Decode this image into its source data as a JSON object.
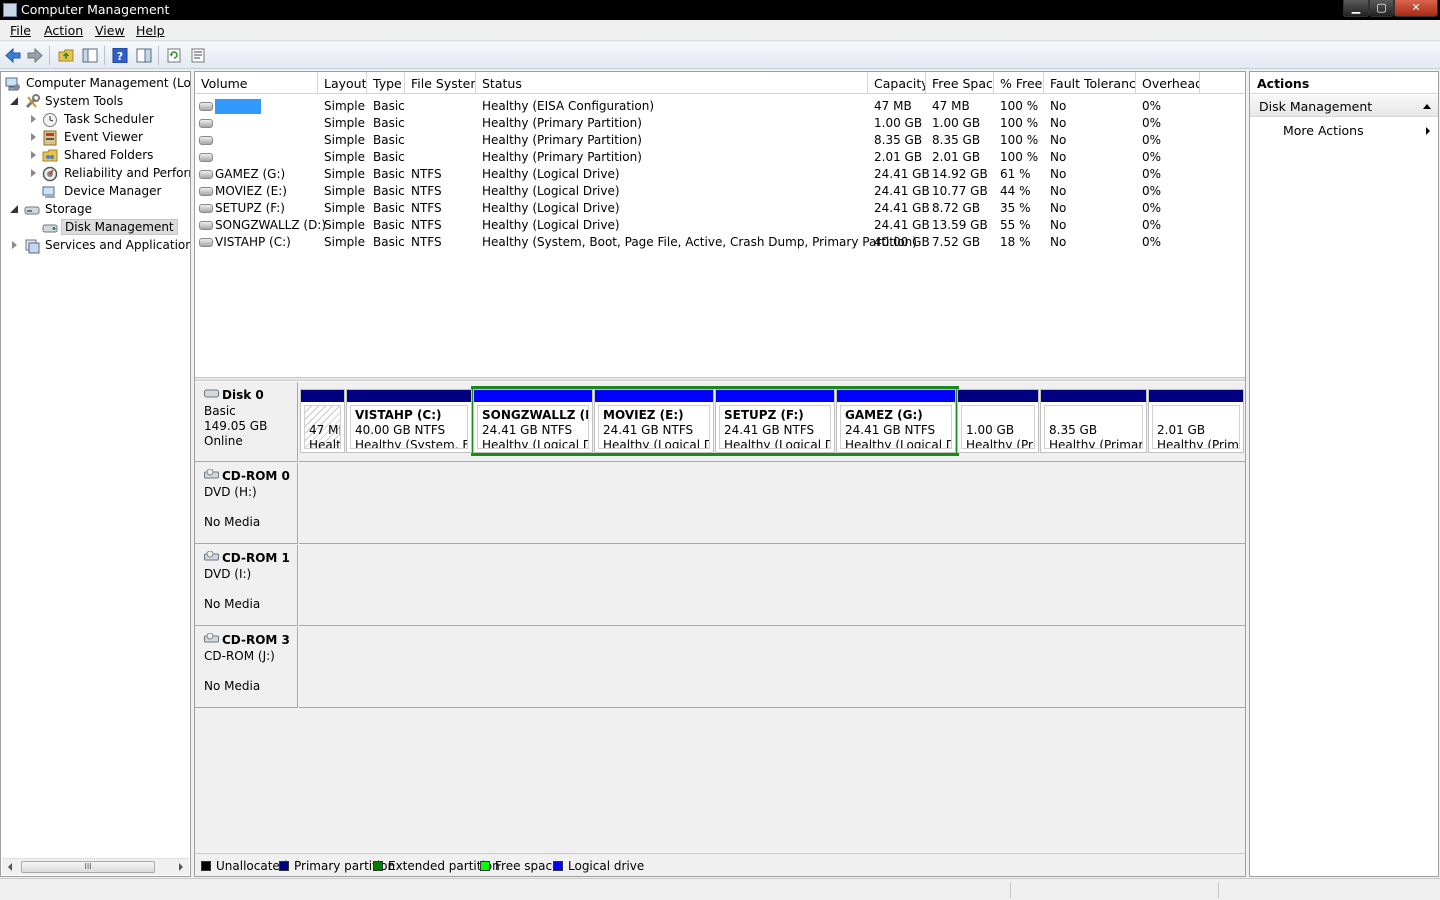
{
  "window": {
    "title": "Computer Management",
    "controls": {
      "minimize": "▁",
      "maximize": "▢",
      "close": "✕"
    }
  },
  "menu": [
    {
      "label": "File"
    },
    {
      "label": "Action"
    },
    {
      "label": "View"
    },
    {
      "label": "Help"
    }
  ],
  "toolbar": {
    "icons": [
      "back-arrow-icon",
      "forward-arrow-icon",
      "up-folder-icon",
      "show-hide-tree-icon",
      "help-icon",
      "properties-icon",
      "refresh-icon",
      "export-list-icon"
    ]
  },
  "tree": {
    "items": [
      {
        "label": "Computer Management (Local",
        "icon": "computer-management-icon",
        "expander": "none"
      },
      {
        "label": "System Tools",
        "icon": "system-tools-icon",
        "expander": "open"
      },
      {
        "label": "Task Scheduler",
        "icon": "clock-icon",
        "expander": "closed"
      },
      {
        "label": "Event Viewer",
        "icon": "event-viewer-icon",
        "expander": "closed"
      },
      {
        "label": "Shared Folders",
        "icon": "shared-folder-icon",
        "expander": "closed"
      },
      {
        "label": "Reliability and Performa",
        "icon": "performance-gauge-icon",
        "expander": "closed"
      },
      {
        "label": "Device Manager",
        "icon": "device-manager-icon",
        "expander": "none"
      },
      {
        "label": "Storage",
        "icon": "storage-icon",
        "expander": "open"
      },
      {
        "label": "Disk Management",
        "icon": "disk-management-icon",
        "expander": "none",
        "selected": true
      },
      {
        "label": "Services and Applications",
        "icon": "services-icon",
        "expander": "closed"
      }
    ],
    "scroll_thumb_glyph": "III"
  },
  "volume_table": {
    "columns": [
      "Volume",
      "Layout",
      "Type",
      "File System",
      "Status",
      "Capacity",
      "Free Space",
      "% Free",
      "Fault Tolerance",
      "Overhead"
    ],
    "rows": [
      {
        "volume": "",
        "layout": "Simple",
        "type": "Basic",
        "fs": "",
        "status": "Healthy (EISA Configuration)",
        "capacity": "47 MB",
        "free": "47 MB",
        "pct": "100 %",
        "fault": "No",
        "overhead": "0%",
        "selected": true
      },
      {
        "volume": "",
        "layout": "Simple",
        "type": "Basic",
        "fs": "",
        "status": "Healthy (Primary Partition)",
        "capacity": "1.00 GB",
        "free": "1.00 GB",
        "pct": "100 %",
        "fault": "No",
        "overhead": "0%"
      },
      {
        "volume": "",
        "layout": "Simple",
        "type": "Basic",
        "fs": "",
        "status": "Healthy (Primary Partition)",
        "capacity": "8.35 GB",
        "free": "8.35 GB",
        "pct": "100 %",
        "fault": "No",
        "overhead": "0%"
      },
      {
        "volume": "",
        "layout": "Simple",
        "type": "Basic",
        "fs": "",
        "status": "Healthy (Primary Partition)",
        "capacity": "2.01 GB",
        "free": "2.01 GB",
        "pct": "100 %",
        "fault": "No",
        "overhead": "0%"
      },
      {
        "volume": "GAMEZ (G:)",
        "layout": "Simple",
        "type": "Basic",
        "fs": "NTFS",
        "status": "Healthy (Logical Drive)",
        "capacity": "24.41 GB",
        "free": "14.92 GB",
        "pct": "61 %",
        "fault": "No",
        "overhead": "0%"
      },
      {
        "volume": "MOVIEZ (E:)",
        "layout": "Simple",
        "type": "Basic",
        "fs": "NTFS",
        "status": "Healthy (Logical Drive)",
        "capacity": "24.41 GB",
        "free": "10.77 GB",
        "pct": "44 %",
        "fault": "No",
        "overhead": "0%"
      },
      {
        "volume": "SETUPZ (F:)",
        "layout": "Simple",
        "type": "Basic",
        "fs": "NTFS",
        "status": "Healthy (Logical Drive)",
        "capacity": "24.41 GB",
        "free": "8.72 GB",
        "pct": "35 %",
        "fault": "No",
        "overhead": "0%"
      },
      {
        "volume": "SONGZWALLZ (D:)",
        "layout": "Simple",
        "type": "Basic",
        "fs": "NTFS",
        "status": "Healthy (Logical Drive)",
        "capacity": "24.41 GB",
        "free": "13.59 GB",
        "pct": "55 %",
        "fault": "No",
        "overhead": "0%"
      },
      {
        "volume": "VISTAHP (C:)",
        "layout": "Simple",
        "type": "Basic",
        "fs": "NTFS",
        "status": "Healthy (System, Boot, Page File, Active, Crash Dump, Primary Partition)",
        "capacity": "40.00 GB",
        "free": "7.52 GB",
        "pct": "18 %",
        "fault": "No",
        "overhead": "0%"
      }
    ]
  },
  "disks": [
    {
      "name": "Disk 0",
      "lines": [
        "Basic",
        "149.05 GB",
        "Online"
      ],
      "partitions": [
        {
          "name": "",
          "size": "47 ME",
          "status": "Healtl",
          "kind": "primary",
          "hatched": true
        },
        {
          "name": "VISTAHP  (C:)",
          "size": "40.00 GB NTFS",
          "status": "Healthy (System, Boc",
          "kind": "primary"
        },
        {
          "name": "SONGZWALLZ  (D:",
          "size": "24.41 GB NTFS",
          "status": "Healthy (Logical Dr",
          "kind": "logical"
        },
        {
          "name": "MOVIEZ  (E:)",
          "size": "24.41 GB NTFS",
          "status": "Healthy (Logical Dri",
          "kind": "logical"
        },
        {
          "name": "SETUPZ  (F:)",
          "size": "24.41 GB NTFS",
          "status": "Healthy (Logical Dri",
          "kind": "logical"
        },
        {
          "name": "GAMEZ  (G:)",
          "size": "24.41 GB NTFS",
          "status": "Healthy (Logical Dr",
          "kind": "logical"
        },
        {
          "name": "",
          "size": "1.00 GB",
          "status": "Healthy (Prir",
          "kind": "primary"
        },
        {
          "name": "",
          "size": "8.35 GB",
          "status": "Healthy (Primary",
          "kind": "primary"
        },
        {
          "name": "",
          "size": "2.01 GB",
          "status": "Healthy (Prima",
          "kind": "primary"
        }
      ]
    },
    {
      "name": "CD-ROM 0",
      "lines": [
        "DVD (H:)",
        "",
        "No Media"
      ]
    },
    {
      "name": "CD-ROM 1",
      "lines": [
        "DVD (I:)",
        "",
        "No Media"
      ]
    },
    {
      "name": "CD-ROM 3",
      "lines": [
        "CD-ROM (J:)",
        "",
        "No Media"
      ]
    }
  ],
  "legend": [
    {
      "label": "Unallocated",
      "color": "#000000"
    },
    {
      "label": "Primary partition",
      "color": "#000080"
    },
    {
      "label": "Extended partition",
      "color": "#008000"
    },
    {
      "label": "Free space",
      "color": "#00ff00"
    },
    {
      "label": "Logical drive",
      "color": "#0000ff"
    }
  ],
  "actions": {
    "title": "Actions",
    "section": "Disk Management",
    "more": "More Actions"
  },
  "colors": {
    "primary_bar": "#000080",
    "logical_bar": "#0000ff",
    "extended_frame": "#1a8a1a",
    "selection": "#3399ff"
  }
}
